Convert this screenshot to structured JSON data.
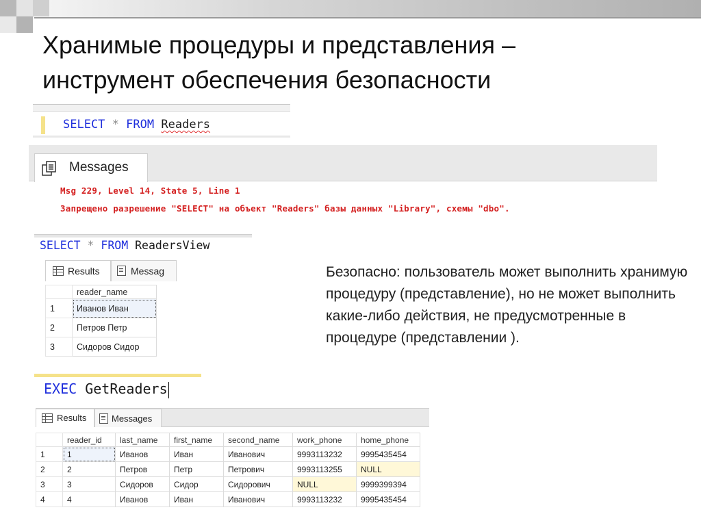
{
  "slide": {
    "title_line1": "Хранимые процедуры и представления –",
    "title_line2": "инструмент обеспечения безопасности",
    "description": "Безопасно: пользователь может выполнить хранимую процедуру (представление), но не может выполнить какие-либо действия, не предусмотренные в процедуре (представлении )."
  },
  "query1": {
    "kw_select": "SELECT",
    "star": "*",
    "kw_from": "FROM",
    "table": "Readers"
  },
  "messages_panel": {
    "tab_label": "Messages",
    "error_line1": "Msg 229, Level 14, State 5, Line 1",
    "error_line2": "Запрещено разрешение \"SELECT\" на объект \"Readers\" базы данных \"Library\", схемы \"dbo\"."
  },
  "query2": {
    "kw_select": "SELECT",
    "star": "*",
    "kw_from": "FROM",
    "view": "ReadersView"
  },
  "results_view": {
    "tab_results": "Results",
    "tab_messages": "Messag",
    "column": "reader_name",
    "rows": [
      {
        "n": "1",
        "reader_name": "Иванов Иван"
      },
      {
        "n": "2",
        "reader_name": "Петров Петр"
      },
      {
        "n": "3",
        "reader_name": "Сидоров Сидор"
      }
    ]
  },
  "query3": {
    "kw_exec": "EXEC",
    "proc": "GetReaders"
  },
  "results_proc": {
    "tab_results": "Results",
    "tab_messages": "Messages",
    "columns": [
      "reader_id",
      "last_name",
      "first_name",
      "second_name",
      "work_phone",
      "home_phone"
    ],
    "rows": [
      [
        "1",
        "1",
        "Иванов",
        "Иван",
        "Иванович",
        "9993113232",
        "9995435454"
      ],
      [
        "2",
        "2",
        "Петров",
        "Петр",
        "Петрович",
        "9993113255",
        "NULL"
      ],
      [
        "3",
        "3",
        "Сидоров",
        "Сидор",
        "Сидорович",
        "NULL",
        "9999399394"
      ],
      [
        "4",
        "4",
        "Иванов",
        "Иван",
        "Иванович",
        "9993113232",
        "9995435454"
      ]
    ]
  },
  "colors": {
    "keyword": "#1f2fdc",
    "error": "#d42020",
    "accent_yellow": "#f5e28a"
  }
}
